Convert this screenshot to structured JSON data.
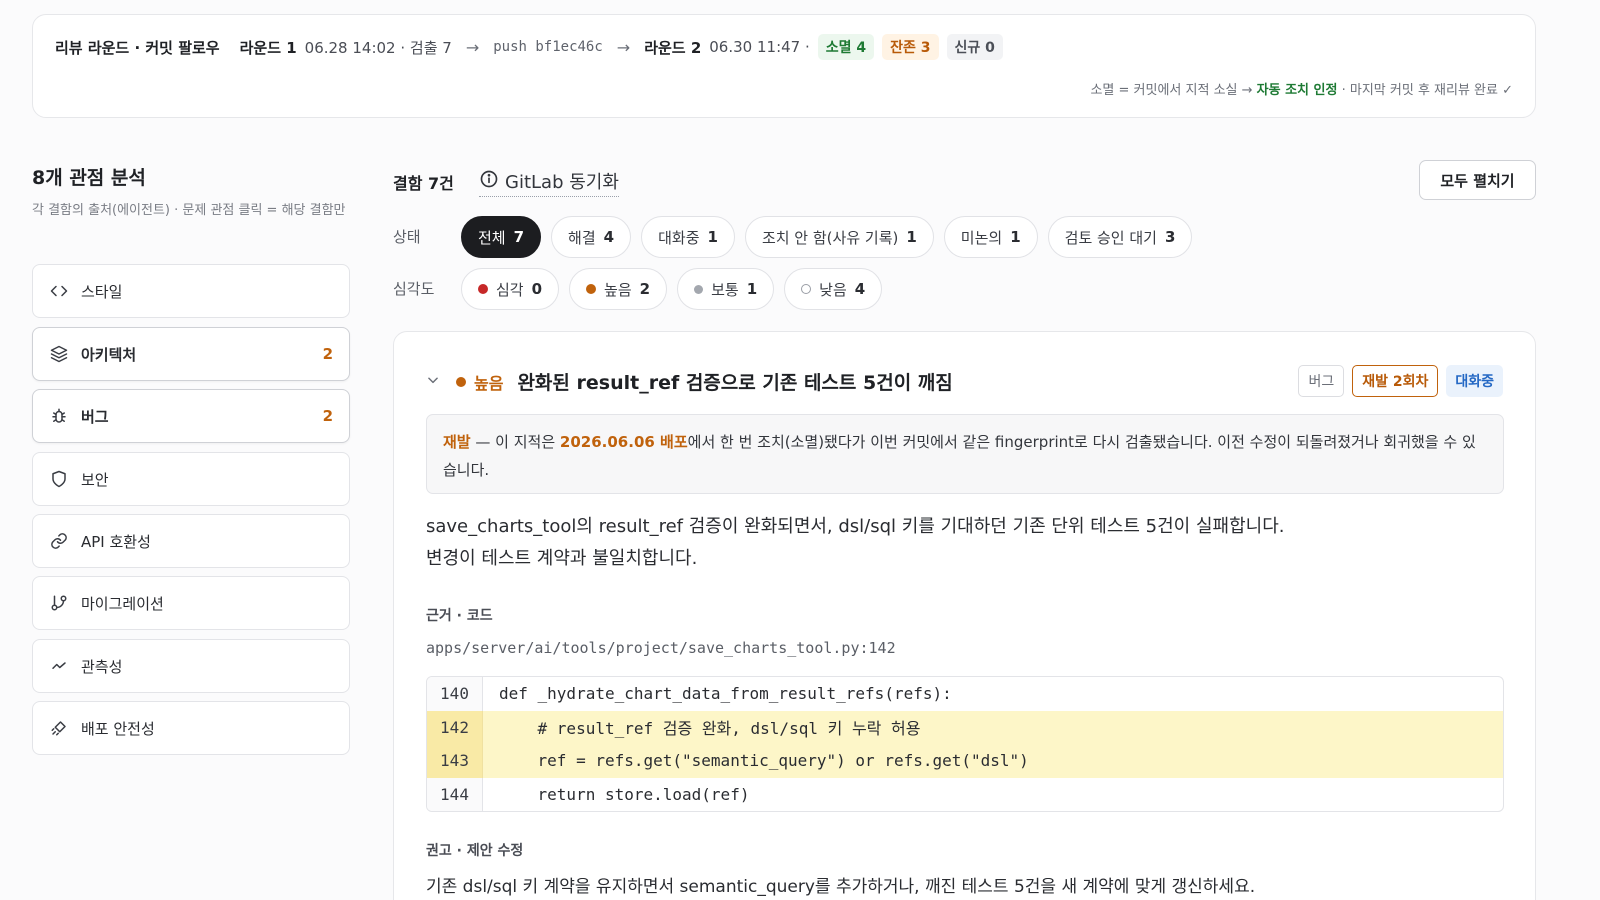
{
  "banner": {
    "title": "리뷰 라운드 · 커밋 팔로우",
    "round1_label": "라운드 1",
    "round1_meta": "06.28 14:02 · 검출 7",
    "arrow": "→",
    "push_text": "push bf1ec46c",
    "round2_label": "라운드 2",
    "round2_meta": "06.30 11:47 ·",
    "badges": [
      {
        "text": "소멸 4",
        "color": "#1e7a34"
      },
      {
        "text": "잔존 3",
        "color": "#b85a08"
      },
      {
        "text": "신규 0",
        "color": "#4b4f57"
      }
    ],
    "note_prefix": "소멸 = 커밋에서 지적 소실 →",
    "note_strong": "자동 조치 인정",
    "note_suffix": "· 마지막 커밋 후 재리뷰 완료 ✓"
  },
  "sidebar": {
    "title": "8개 관점 분석",
    "subtitle": "각 결함의 출처(에이전트) · 문제 관점 클릭 = 해당 결함만",
    "items": [
      {
        "label": "스타일",
        "icon": "code-icon",
        "count": ""
      },
      {
        "label": "아키텍처",
        "icon": "layers-icon",
        "count": "2"
      },
      {
        "label": "버그",
        "icon": "bug-icon",
        "count": "2"
      },
      {
        "label": "보안",
        "icon": "shield-icon",
        "count": ""
      },
      {
        "label": "API 호환성",
        "icon": "link-icon",
        "count": ""
      },
      {
        "label": "마이그레이션",
        "icon": "git-branch-icon",
        "count": ""
      },
      {
        "label": "관측성",
        "icon": "activity-icon",
        "count": ""
      },
      {
        "label": "배포 안전성",
        "icon": "rocket-icon",
        "count": ""
      }
    ]
  },
  "main": {
    "title": "결함 7건",
    "gitlab_sync": "GitLab 동기화",
    "expand_all": "모두 펼치기",
    "status_label": "상태",
    "status_filters": [
      {
        "label": "전체",
        "count": "7",
        "active": true
      },
      {
        "label": "해결",
        "count": "4"
      },
      {
        "label": "대화중",
        "count": "1"
      },
      {
        "label": "조치 안 함(사유 기록)",
        "count": "1"
      },
      {
        "label": "미논의",
        "count": "1"
      },
      {
        "label": "검토 승인 대기",
        "count": "3"
      }
    ],
    "severity_label": "심각도",
    "severity_filters": [
      {
        "label": "심각",
        "count": "0",
        "color": "#c62828"
      },
      {
        "label": "높음",
        "count": "2",
        "color": "#c0620c"
      },
      {
        "label": "보통",
        "count": "1",
        "color": "#9a9ea6"
      },
      {
        "label": "낮음",
        "count": "4",
        "color": "#9a9ea6"
      }
    ]
  },
  "finding": {
    "severity": "높음",
    "title": "완화된 result_ref 검증으로 기존 테스트 5건이 깨짐",
    "tags": [
      "버그",
      "재발 2회차",
      "대화중"
    ],
    "recur_word": "재발",
    "recur_mid": "— 이 지적은",
    "recur_deploy": "2026.06.06 배포",
    "recur_rest": "에서 한 번 조치(소멸)됐다가 이번 커밋에서 같은 fingerprint로 다시 검출됐습니다. 이전 수정이 되돌려졌거나 회귀했을 수 있습니다.",
    "description": "save_charts_tool의 result_ref 검증이 완화되면서, dsl/sql 키를 기대하던 기존 단위 테스트 5건이 실패합니다. 변경이 테스트 계약과 불일치합니다.",
    "evidence_label": "근거 · 코드",
    "file_path": "apps/server/ai/tools/project/save_charts_tool.py:142",
    "code_lines": [
      {
        "no": "140",
        "text": "def _hydrate_chart_data_from_result_refs(refs):",
        "hl": false
      },
      {
        "no": "142",
        "text": "    # result_ref 검증 완화, dsl/sql 키 누락 허용",
        "hl": true
      },
      {
        "no": "143",
        "text": "    ref = refs.get(\"semantic_query\") or refs.get(\"dsl\")",
        "hl": true
      },
      {
        "no": "144",
        "text": "    return store.load(ref)",
        "hl": false
      }
    ],
    "recommend_label": "권고 · 제안 수정",
    "recommend_text": "기존 dsl/sql 키 계약을 유지하면서 semantic_query를 추가하거나, 깨진 테스트 5건을 새 계약에 맞게 갱신하세요."
  }
}
